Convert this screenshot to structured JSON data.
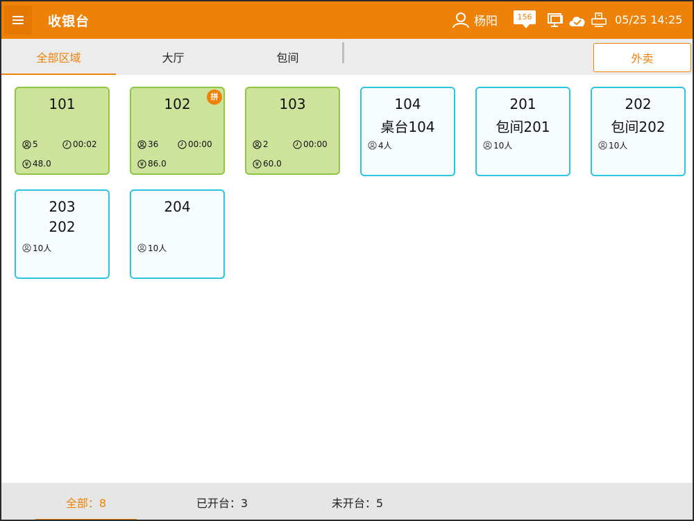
{
  "header": {
    "title": "收银台",
    "user_name": "杨阳",
    "message_count": "156",
    "datetime": "05/25 14:25"
  },
  "tabs": {
    "all": "全部区域",
    "hall": "大厅",
    "room": "包间",
    "takeout": "外卖"
  },
  "tables": [
    {
      "number": "101",
      "name": "",
      "status": "occupied",
      "guests": "5",
      "time": "00:02",
      "amount": "48.0",
      "pin": ""
    },
    {
      "number": "102",
      "name": "",
      "status": "occupied",
      "guests": "36",
      "time": "00:00",
      "amount": "86.0",
      "pin": "拼"
    },
    {
      "number": "103",
      "name": "",
      "status": "occupied",
      "guests": "2",
      "time": "00:00",
      "amount": "60.0",
      "pin": ""
    },
    {
      "number": "104",
      "name": "桌台104",
      "status": "free",
      "capacity": "4人"
    },
    {
      "number": "201",
      "name": "包间201",
      "status": "free",
      "capacity": "10人"
    },
    {
      "number": "202",
      "name": "包间202",
      "status": "free",
      "capacity": "10人"
    },
    {
      "number": "203",
      "name": "202",
      "status": "free",
      "capacity": "10人"
    },
    {
      "number": "204",
      "name": "",
      "status": "free",
      "capacity": "10人"
    }
  ],
  "footer": {
    "all": "全部：8",
    "open": "已开台：3",
    "unopened": "未开台：5"
  },
  "colors": {
    "accent": "#ee8208",
    "occupied_fill": "#cde39c",
    "occupied_border": "#8ec63f",
    "free_border": "#2cc4e0"
  }
}
